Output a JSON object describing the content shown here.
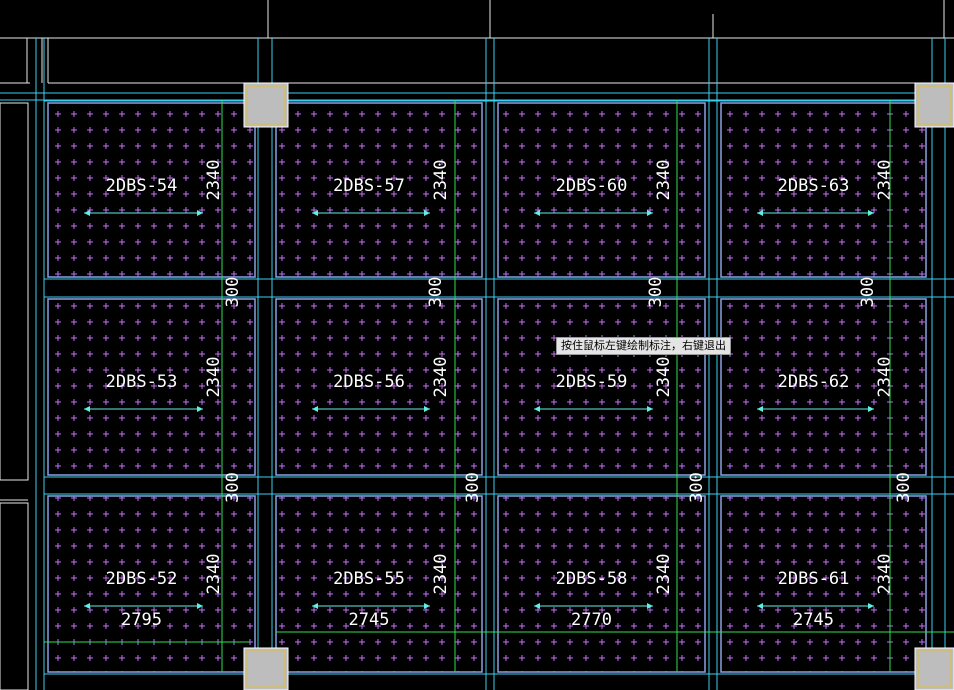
{
  "colors": {
    "background": "#000000",
    "slab_border": "#8aa0e0",
    "slab_dots": "#c070ff",
    "beam_cyan": "#39d0f0",
    "dim_green": "#30e050",
    "column": "#c8c8c8",
    "grid_white": "#e8e8e8",
    "label": "#ffffff",
    "arrow": "#5ff0e0"
  },
  "tooltip": "按住鼠标左键绘制标注，右键退出",
  "slabs": [
    {
      "label": "2DBS-54",
      "width_dim": "2340",
      "length_dim": ""
    },
    {
      "label": "2DBS-57",
      "width_dim": "2340",
      "length_dim": ""
    },
    {
      "label": "2DBS-60",
      "width_dim": "2340",
      "length_dim": ""
    },
    {
      "label": "2DBS-63",
      "width_dim": "2340",
      "length_dim": ""
    },
    {
      "label": "2DBS-53",
      "width_dim": "2340",
      "length_dim": ""
    },
    {
      "label": "2DBS-56",
      "width_dim": "2340",
      "length_dim": ""
    },
    {
      "label": "2DBS-59",
      "width_dim": "2340",
      "length_dim": ""
    },
    {
      "label": "2DBS-62",
      "width_dim": "2340",
      "length_dim": ""
    },
    {
      "label": "2DBS-52",
      "width_dim": "2340",
      "length_dim": "2795"
    },
    {
      "label": "2DBS-55",
      "width_dim": "2340",
      "length_dim": "2745"
    },
    {
      "label": "2DBS-58",
      "width_dim": "2340",
      "length_dim": "2770"
    },
    {
      "label": "2DBS-61",
      "width_dim": "2340",
      "length_dim": "2745"
    }
  ],
  "gap_dims": [
    {
      "text": "300",
      "row": 0,
      "col": 0
    },
    {
      "text": "300",
      "row": 0,
      "col": 1
    },
    {
      "text": "300",
      "row": 0,
      "col": 2
    },
    {
      "text": "300",
      "row": 0,
      "col": 3
    },
    {
      "text": "300",
      "row": 1,
      "col": 0
    },
    {
      "text": "300",
      "row": 1,
      "col": 1
    },
    {
      "text": "300",
      "row": 1,
      "col": 2
    },
    {
      "text": "300",
      "row": 1,
      "col": 3
    }
  ]
}
